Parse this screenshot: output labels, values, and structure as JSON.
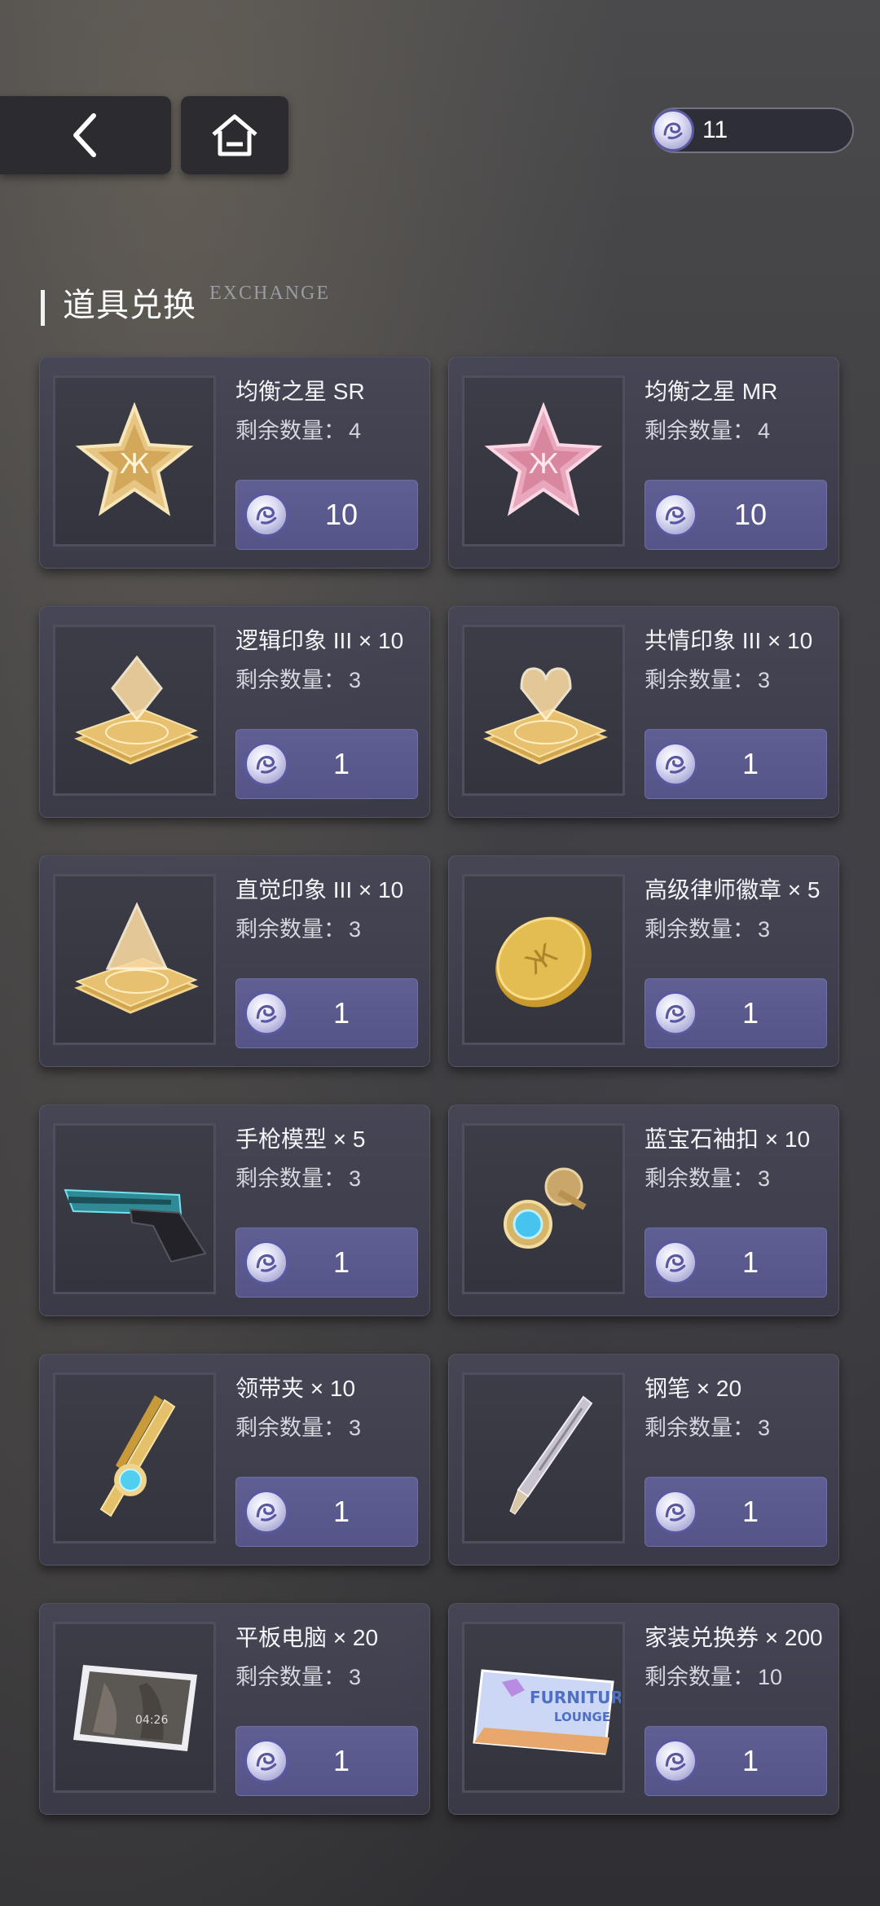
{
  "header": {
    "currency_amount": "11"
  },
  "section": {
    "title": "道具兑换",
    "subtitle": "EXCHANGE"
  },
  "remaining_label": "剩余数量：",
  "items": [
    {
      "name": "均衡之星 SR",
      "remaining": "4",
      "price": "10",
      "icon": "gold-star-badge-icon"
    },
    {
      "name": "均衡之星 MR",
      "remaining": "4",
      "price": "10",
      "icon": "pink-star-badge-icon"
    },
    {
      "name": "逻辑印象 III × 10",
      "remaining": "3",
      "price": "1",
      "icon": "logic-impression-icon"
    },
    {
      "name": "共情印象 III × 10",
      "remaining": "3",
      "price": "1",
      "icon": "empathy-impression-icon"
    },
    {
      "name": "直觉印象 III × 10",
      "remaining": "3",
      "price": "1",
      "icon": "intuition-impression-icon"
    },
    {
      "name": "高级律师徽章 × 5",
      "remaining": "3",
      "price": "1",
      "icon": "lawyer-badge-icon"
    },
    {
      "name": "手枪模型 × 5",
      "remaining": "3",
      "price": "1",
      "icon": "pistol-model-icon"
    },
    {
      "name": "蓝宝石袖扣 × 10",
      "remaining": "3",
      "price": "1",
      "icon": "sapphire-cufflink-icon"
    },
    {
      "name": "领带夹 × 10",
      "remaining": "3",
      "price": "1",
      "icon": "tie-clip-icon"
    },
    {
      "name": "钢笔 × 20",
      "remaining": "3",
      "price": "1",
      "icon": "fountain-pen-icon"
    },
    {
      "name": "平板电脑 × 20",
      "remaining": "3",
      "price": "1",
      "icon": "tablet-icon"
    },
    {
      "name": "家装兑换券 × 200",
      "remaining": "10",
      "price": "1",
      "icon": "furniture-voucher-icon"
    }
  ],
  "voucher_text": {
    "line1": "FURNITURE",
    "line2": "LOUNGE"
  },
  "tablet_text": "04:26",
  "colors": {
    "button": "#5a5a90",
    "card": "#44445a",
    "coin_border": "#5a58a0"
  }
}
